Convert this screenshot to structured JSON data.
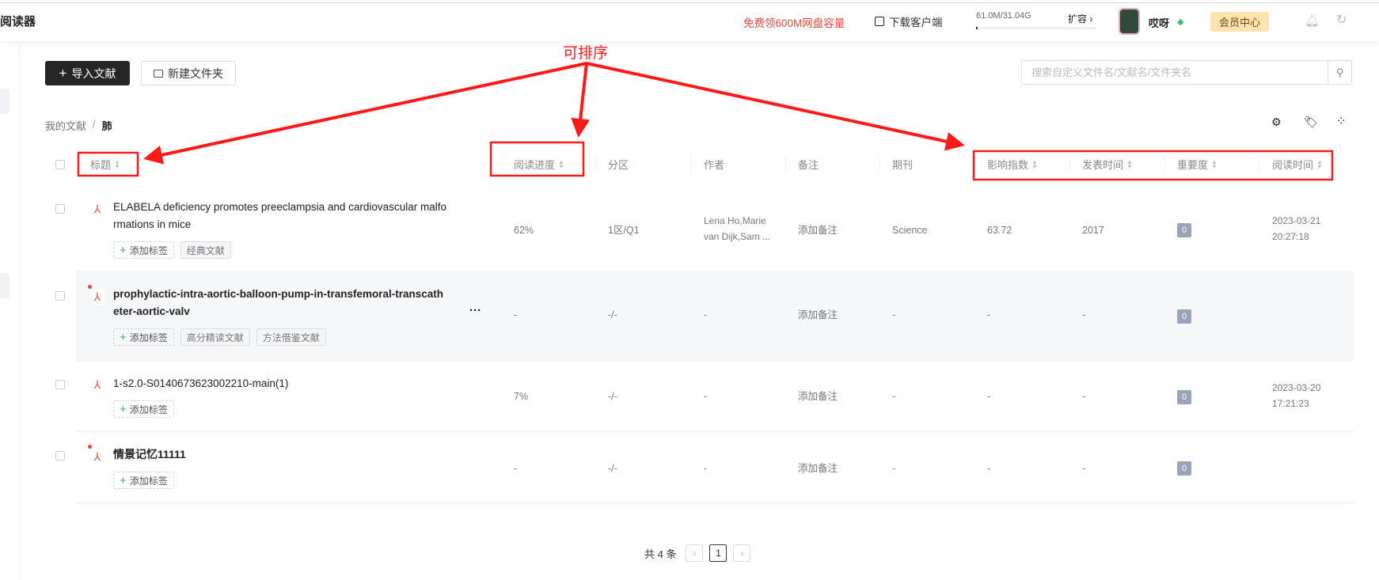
{
  "app": {
    "title": "阅读器"
  },
  "header": {
    "promo": "免费领600M网盘容量",
    "download": "下载客户端",
    "storage": "61.0M/31.04G",
    "storage_fraction": 0.002,
    "expand": "扩容 ›",
    "username": "哎呀",
    "vip": "会员中心"
  },
  "toolbar": {
    "import": "导入文献",
    "new_folder": "新建文件夹",
    "search_placeholder": "搜索自定义文件名/文献名/文件夹名"
  },
  "breadcrumb": {
    "root": "我的文献",
    "sep": "/",
    "current": "肺"
  },
  "columns": {
    "title": "标题",
    "progress": "阅读进度",
    "zone": "分区",
    "author": "作者",
    "note": "备注",
    "journal": "期刊",
    "impact": "影响指数",
    "pubtime": "发表时间",
    "importance": "重要度",
    "readtime": "阅读时间"
  },
  "rows": [
    {
      "title1": "ELABELA deficiency promotes preeclampsia and cardiovascular malfo",
      "title2": "rmations in mice",
      "unread": false,
      "tags": [
        "经典文献"
      ],
      "progress": "62%",
      "zone": "1区/Q1",
      "author1": "Lena Ho,Marie",
      "author2": "van Dijk,Sam ...",
      "note": "添加备注",
      "journal": "Science",
      "impact": "63.72",
      "pubtime": "2017",
      "importance": "0",
      "read1": "2023-03-21",
      "read2": "20:27:18"
    },
    {
      "title1": "prophylactic-intra-aortic-balloon-pump-in-transfemoral-transcath",
      "title2": "eter-aortic-valv",
      "unread": true,
      "tags": [
        "高分精读文献",
        "方法借鉴文献"
      ],
      "progress": "-",
      "zone": "-/-",
      "author1": "-",
      "note": "添加备注",
      "journal": "-",
      "impact": "-",
      "pubtime": "-",
      "importance": "0",
      "more": "···"
    },
    {
      "title1": "1-s2.0-S0140673623002210-main(1)",
      "unread": false,
      "tags": [],
      "progress": "7%",
      "zone": "-/-",
      "author1": "-",
      "note": "添加备注",
      "journal": "-",
      "impact": "-",
      "pubtime": "-",
      "importance": "0",
      "read1": "2023-03-20",
      "read2": "17:21:23"
    },
    {
      "title1": "情景记忆11111",
      "unread": true,
      "tags": [],
      "progress": "-",
      "zone": "-/-",
      "author1": "-",
      "note": "添加备注",
      "journal": "-",
      "impact": "-",
      "pubtime": "-",
      "importance": "0"
    }
  ],
  "add_tag": "添加标签",
  "pagination": {
    "total": "共 4 条",
    "prev": "‹",
    "page": "1",
    "next": "›"
  },
  "annotation": {
    "label": "可排序",
    "color": "#ff1a1a"
  }
}
